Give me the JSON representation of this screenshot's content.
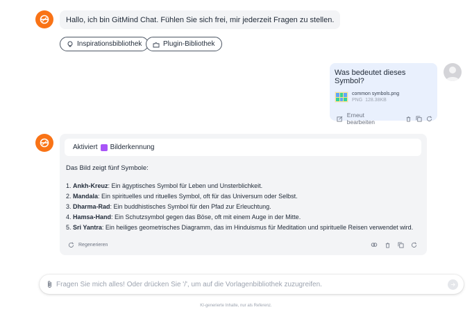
{
  "greeting": {
    "text": "Hallo, ich bin GitMind Chat. Fühlen Sie sich frei, mir jederzeit Fragen zu stellen.",
    "pills": [
      {
        "label": "Inspirationsbibliothek",
        "icon": "lightbulb-icon"
      },
      {
        "label": "Plugin-Bibliothek",
        "icon": "puzzle-icon"
      }
    ]
  },
  "user_message": {
    "question": "Was bedeutet dieses Symbol?",
    "file": {
      "name": "common symbols.png",
      "type": "PNG",
      "size": "128.38KB"
    },
    "edit_label": "Erneut bearbeiten"
  },
  "answer": {
    "activated_prefix": "Aktiviert",
    "activated_feature": "Bilderkennung",
    "intro": "Das Bild zeigt fünf Symbole:",
    "items": [
      {
        "num": "1.",
        "term": "Ankh-Kreuz",
        "desc": ": Ein ägyptisches Symbol für Leben und Unsterblichkeit."
      },
      {
        "num": "2.",
        "term": "Mandala",
        "desc": ": Ein spirituelles und rituelles Symbol, oft für das Universum oder Selbst."
      },
      {
        "num": "3.",
        "term": "Dharma-Rad",
        "desc": ": Ein buddhistisches Symbol für den Pfad zur Erleuchtung."
      },
      {
        "num": "4.",
        "term": "Hamsa-Hand",
        "desc": ": Ein Schutzsymbol gegen das Böse, oft mit einem Auge in der Mitte."
      },
      {
        "num": "5.",
        "term": "Sri Yantra",
        "desc": ": Ein heiliges geometrisches Diagramm, das im Hinduismus für Meditation und spirituelle Reisen verwendet wird."
      }
    ],
    "regenerate_label": "Regenerieren"
  },
  "input": {
    "placeholder": "Fragen Sie mich alles! Oder drücken Sie '/', um auf die Vorlagenbibliothek zuzugreifen."
  },
  "footer": {
    "note": "KI-generierte Inhalte, nur als Referenz."
  },
  "colors": {
    "accent": "#f97316",
    "user_bubble": "#e9f0fd",
    "bot_bubble": "#f3f4f6",
    "feature_badge": "#a855f7"
  }
}
